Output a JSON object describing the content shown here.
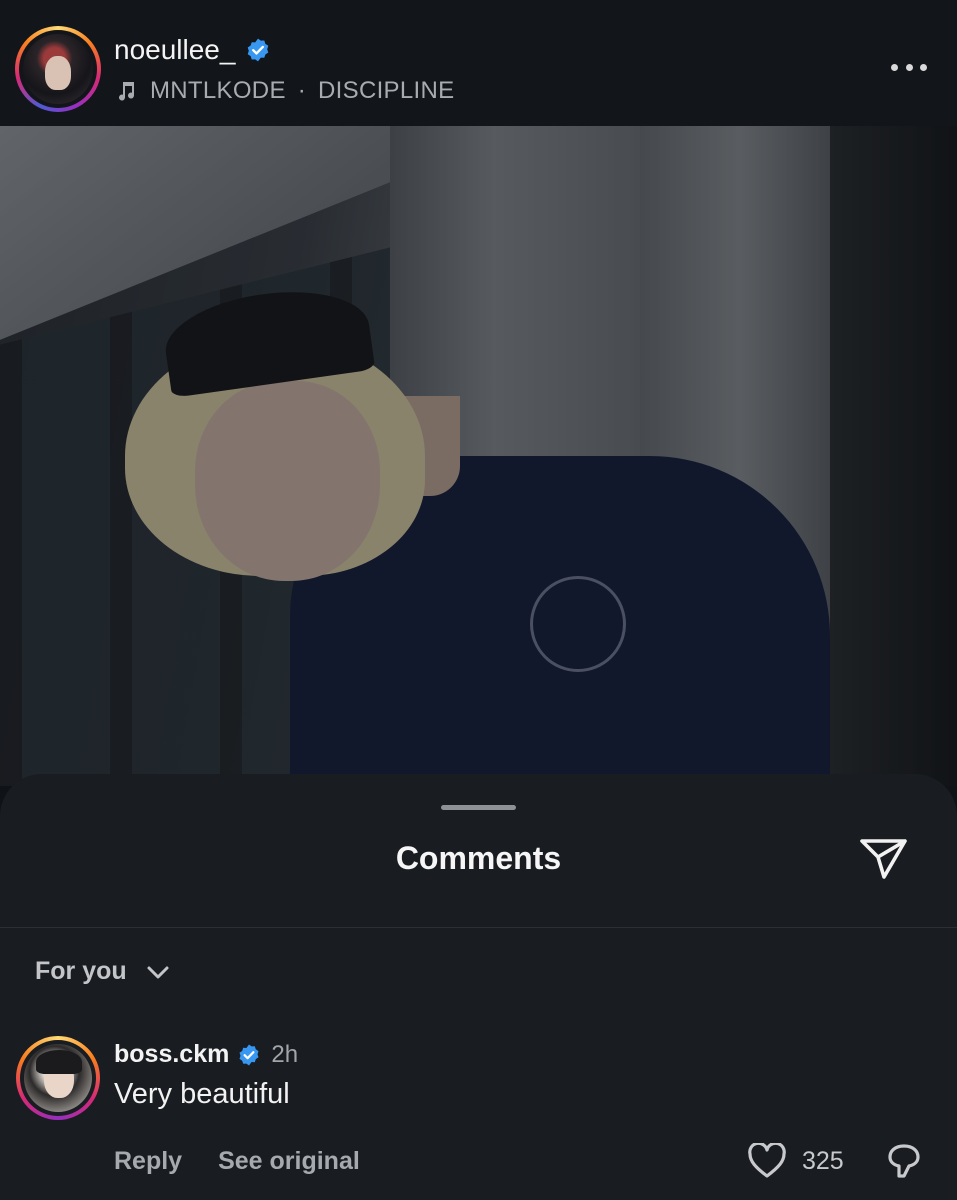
{
  "post": {
    "username": "noeullee_",
    "verified": true,
    "music": {
      "artist": "MNTLKODE",
      "separator": "·",
      "track": "DISCIPLINE"
    },
    "more_icon": "more-horizontal-icon"
  },
  "comments_sheet": {
    "title": "Comments",
    "share_icon": "send-icon",
    "sort": {
      "label": "For you",
      "icon": "chevron-down-icon"
    },
    "comments": [
      {
        "username": "boss.ckm",
        "verified": true,
        "time": "2h",
        "text": "Very beautiful",
        "reply_label": "Reply",
        "see_original_label": "See original",
        "likes": "325"
      }
    ]
  },
  "colors": {
    "background": "#0f1216",
    "sheet": "#191c20",
    "verified_badge": "#3897f0",
    "secondary_text": "#a8abb0"
  }
}
